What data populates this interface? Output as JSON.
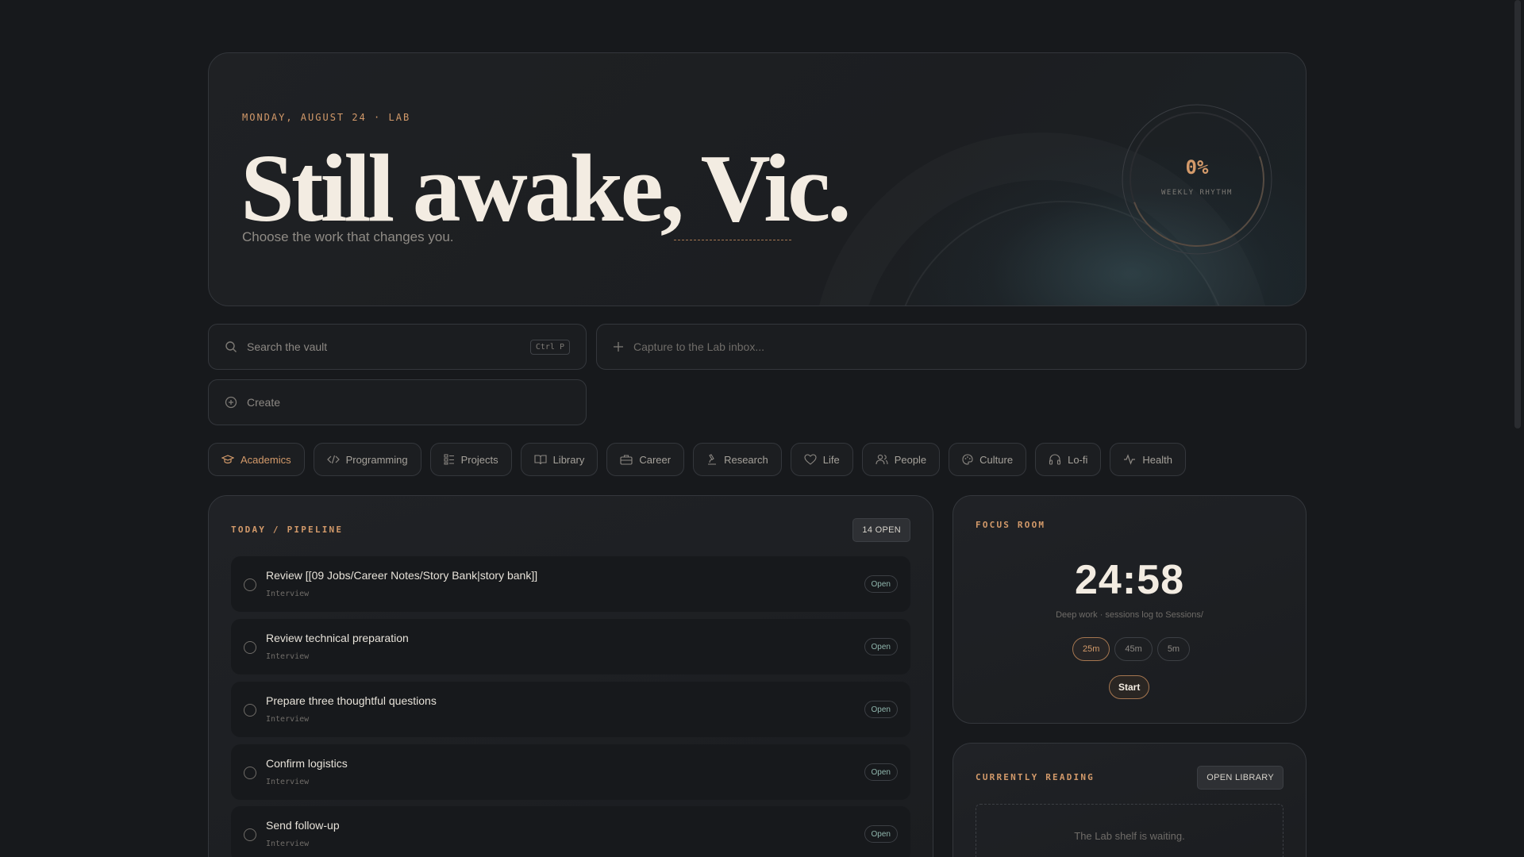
{
  "hero": {
    "date_line": "MONDAY, AUGUST 24 · LAB",
    "greeting": "Still awake, Vic.",
    "subtitle": "Choose the work that changes you.",
    "rhythm_value": "0%",
    "rhythm_label": "WEEKLY RHYTHM",
    "rhythm_progress": 0
  },
  "search": {
    "placeholder": "Search the vault",
    "shortcut": "Ctrl P"
  },
  "capture": {
    "placeholder": "Capture to the Lab inbox..."
  },
  "create": {
    "label": "Create"
  },
  "categories": [
    {
      "label": "Academics",
      "icon": "graduation-cap-icon",
      "active": true
    },
    {
      "label": "Programming",
      "icon": "code-icon"
    },
    {
      "label": "Projects",
      "icon": "list-icon"
    },
    {
      "label": "Library",
      "icon": "book-open-icon"
    },
    {
      "label": "Career",
      "icon": "briefcase-icon"
    },
    {
      "label": "Research",
      "icon": "microscope-icon"
    },
    {
      "label": "Life",
      "icon": "heart-icon"
    },
    {
      "label": "People",
      "icon": "users-icon"
    },
    {
      "label": "Culture",
      "icon": "palette-icon"
    },
    {
      "label": "Lo-fi",
      "icon": "headphones-icon"
    },
    {
      "label": "Health",
      "icon": "activity-icon"
    }
  ],
  "pipeline": {
    "title": "TODAY / PIPELINE",
    "count_label": "14 OPEN",
    "tasks": [
      {
        "title": "Review [[09 Jobs/Career Notes/Story Bank|story bank]]",
        "tag": "Interview",
        "status": "Open"
      },
      {
        "title": "Review technical preparation",
        "tag": "Interview",
        "status": "Open"
      },
      {
        "title": "Prepare three thoughtful questions",
        "tag": "Interview",
        "status": "Open"
      },
      {
        "title": "Confirm logistics",
        "tag": "Interview",
        "status": "Open"
      },
      {
        "title": "Send follow-up",
        "tag": "Interview",
        "status": "Open"
      }
    ]
  },
  "focus": {
    "title": "FOCUS ROOM",
    "timer": "24:58",
    "subtitle": "Deep work · sessions log to Sessions/",
    "durations": [
      "25m",
      "45m",
      "5m"
    ],
    "selected": "25m",
    "start_label": "Start"
  },
  "reading": {
    "title": "CURRENTLY READING",
    "button_label": "OPEN LIBRARY",
    "empty_text": "The Lab shelf is waiting."
  },
  "colors": {
    "accent": "#d39a6a",
    "background": "#17191c",
    "status_open": "#8fb5ac"
  }
}
